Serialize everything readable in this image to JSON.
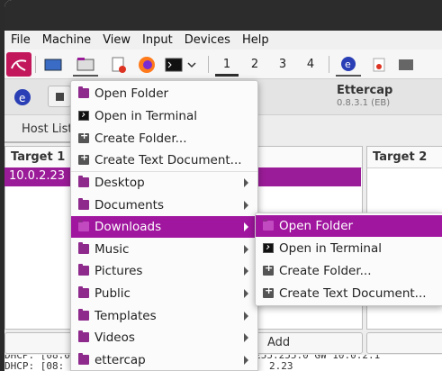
{
  "menubar": {
    "items": [
      {
        "label": "File"
      },
      {
        "label": "Machine"
      },
      {
        "label": "View"
      },
      {
        "label": "Input"
      },
      {
        "label": "Devices"
      },
      {
        "label": "Help"
      }
    ]
  },
  "panel": {
    "workspaces": [
      "1",
      "2",
      "3",
      "4"
    ],
    "active_workspace": "1",
    "icons": [
      "kali-menu-icon",
      "desktop-icon",
      "file-manager-icon",
      "text-editor-icon",
      "firefox-icon",
      "terminal-icon",
      "dropdown-icon",
      "ettercap-icon",
      "ettercap-window-icon",
      "terminal-window-icon"
    ]
  },
  "app": {
    "title": "Ettercap",
    "version": "0.8.3.1 (EB)",
    "tab": "Host List",
    "target1_header": "Target 1",
    "target2_header": "Target 2",
    "target1_rows": [
      "10.0.2.23"
    ],
    "add_button": "Add",
    "log_lines": [
      "DHCP: [08:",
      "2.23"
    ]
  },
  "places_menu": {
    "items": [
      {
        "label": "Open Folder",
        "icon": "folder-icon",
        "submenu": false
      },
      {
        "label": "Open in Terminal",
        "icon": "terminal-icon",
        "submenu": false
      },
      {
        "label": "Create Folder...",
        "icon": "create-folder-icon",
        "submenu": false
      },
      {
        "label": "Create Text Document...",
        "icon": "create-document-icon",
        "submenu": false
      },
      {
        "label": "Desktop",
        "icon": "folder-icon",
        "submenu": true
      },
      {
        "label": "Documents",
        "icon": "folder-icon",
        "submenu": true
      },
      {
        "label": "Downloads",
        "icon": "folder-icon",
        "submenu": true
      },
      {
        "label": "Music",
        "icon": "folder-icon",
        "submenu": true
      },
      {
        "label": "Pictures",
        "icon": "folder-icon",
        "submenu": true
      },
      {
        "label": "Public",
        "icon": "folder-icon",
        "submenu": true
      },
      {
        "label": "Templates",
        "icon": "folder-icon",
        "submenu": true
      },
      {
        "label": "Videos",
        "icon": "folder-icon",
        "submenu": true
      },
      {
        "label": "ettercap",
        "icon": "folder-icon",
        "submenu": true
      }
    ],
    "highlighted": "Downloads"
  },
  "sub_menu": {
    "items": [
      {
        "label": "Open Folder",
        "icon": "folder-icon"
      },
      {
        "label": "Open in Terminal",
        "icon": "terminal-icon"
      },
      {
        "label": "Create Folder...",
        "icon": "create-folder-icon"
      },
      {
        "label": "Create Text Document...",
        "icon": "create-document-icon"
      }
    ],
    "highlighted": "Open Folder"
  },
  "colors": {
    "accent": "#a0169f",
    "selection_row": "#9b1c98",
    "kali_red": "#c2185b"
  }
}
